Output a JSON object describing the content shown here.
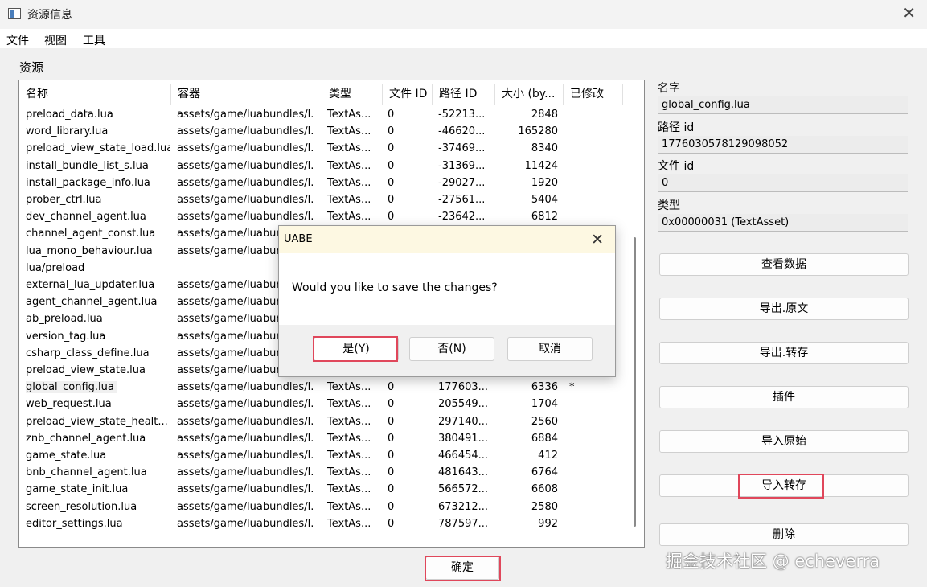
{
  "window": {
    "title": "资源信息",
    "close_glyph": "✕",
    "icon": "app-window-icon"
  },
  "menu": [
    "文件",
    "视图",
    "工具"
  ],
  "asset_group_label": "资源",
  "table": {
    "columns": [
      "名称",
      "容器",
      "类型",
      "文件 ID",
      "路径 ID",
      "大小 (by...",
      "已修改"
    ],
    "rows": [
      [
        "preload_data.lua",
        "assets/game/luabundles/l...",
        "TextAs...",
        "0",
        "-52213...",
        "2848",
        ""
      ],
      [
        "word_library.lua",
        "assets/game/luabundles/l...",
        "TextAs...",
        "0",
        "-46620...",
        "165280",
        ""
      ],
      [
        "preload_view_state_load.lua",
        "assets/game/luabundles/l...",
        "TextAs...",
        "0",
        "-37469...",
        "8340",
        ""
      ],
      [
        "install_bundle_list_s.lua",
        "assets/game/luabundles/l...",
        "TextAs...",
        "0",
        "-31369...",
        "11424",
        ""
      ],
      [
        "install_package_info.lua",
        "assets/game/luabundles/l...",
        "TextAs...",
        "0",
        "-29027...",
        "1920",
        ""
      ],
      [
        "prober_ctrl.lua",
        "assets/game/luabundles/l...",
        "TextAs...",
        "0",
        "-27561...",
        "5404",
        ""
      ],
      [
        "dev_channel_agent.lua",
        "assets/game/luabundles/l...",
        "TextAs...",
        "0",
        "-23642...",
        "6812",
        ""
      ],
      [
        "channel_agent_const.lua",
        "assets/game/luabund",
        "",
        "",
        "",
        "",
        ""
      ],
      [
        "lua_mono_behaviour.lua",
        "assets/game/luabund",
        "",
        "",
        "",
        "",
        ""
      ],
      [
        "lua/preload",
        "",
        "",
        "",
        "",
        "",
        ""
      ],
      [
        "external_lua_updater.lua",
        "assets/game/luabund",
        "",
        "",
        "",
        "",
        ""
      ],
      [
        "agent_channel_agent.lua",
        "assets/game/luabund",
        "",
        "",
        "",
        "",
        ""
      ],
      [
        "ab_preload.lua",
        "assets/game/luabund",
        "",
        "",
        "",
        "",
        ""
      ],
      [
        "version_tag.lua",
        "assets/game/luabund",
        "",
        "",
        "",
        "",
        ""
      ],
      [
        "csharp_class_define.lua",
        "assets/game/luabund",
        "",
        "",
        "",
        "",
        ""
      ],
      [
        "preload_view_state.lua",
        "assets/game/luabund",
        "",
        "",
        "",
        "",
        ""
      ],
      [
        "global_config.lua",
        "assets/game/luabundles/l...",
        "TextAs...",
        "0",
        "177603...",
        "6336",
        "*"
      ],
      [
        "web_request.lua",
        "assets/game/luabundles/l...",
        "TextAs...",
        "0",
        "205549...",
        "1704",
        ""
      ],
      [
        "preload_view_state_healt...",
        "assets/game/luabundles/l...",
        "TextAs...",
        "0",
        "297140...",
        "2560",
        ""
      ],
      [
        "znb_channel_agent.lua",
        "assets/game/luabundles/l...",
        "TextAs...",
        "0",
        "380491...",
        "6884",
        ""
      ],
      [
        "game_state.lua",
        "assets/game/luabundles/l...",
        "TextAs...",
        "0",
        "466454...",
        "412",
        ""
      ],
      [
        "bnb_channel_agent.lua",
        "assets/game/luabundles/l...",
        "TextAs...",
        "0",
        "481643...",
        "6764",
        ""
      ],
      [
        "game_state_init.lua",
        "assets/game/luabundles/l...",
        "TextAs...",
        "0",
        "566572...",
        "6608",
        ""
      ],
      [
        "screen_resolution.lua",
        "assets/game/luabundles/l...",
        "TextAs...",
        "0",
        "673212...",
        "2580",
        ""
      ],
      [
        "editor_settings.lua",
        "assets/game/luabundles/l...",
        "TextAs...",
        "0",
        "787597...",
        "992",
        ""
      ]
    ]
  },
  "ok_button": "确定",
  "side": {
    "name_label": "名字",
    "name_value": "global_config.lua",
    "path_label": "路径 id",
    "path_value": "1776030578129098052",
    "file_label": "文件 id",
    "file_value": "0",
    "type_label": "类型",
    "type_value": "0x00000031 (TextAsset)",
    "buttons": [
      "查看数据",
      "导出.原文",
      "导出.转存",
      "插件",
      "导入原始",
      "导入转存",
      "删除"
    ]
  },
  "dialog": {
    "title": "UABE",
    "close_glyph": "✕",
    "message": "Would you like to save the changes?",
    "yes": "是(Y)",
    "no": "否(N)",
    "cancel": "取消"
  },
  "watermark": "掘金技术社区 @ echeverra",
  "highlight_color": "#e0475b"
}
